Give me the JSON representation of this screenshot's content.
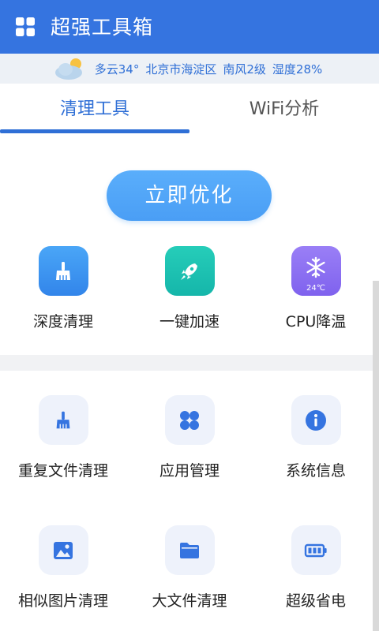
{
  "app": {
    "title": "超强工具箱"
  },
  "weather": {
    "condition_temp": "多云34°",
    "location": "北京市海淀区",
    "wind": "南风2级",
    "humidity": "湿度28%"
  },
  "tabs": [
    {
      "label": "清理工具",
      "active": true
    },
    {
      "label": "WiFi分析",
      "active": false
    }
  ],
  "optimize_button": {
    "label": "立即优化"
  },
  "top_tools": [
    {
      "label": "深度清理",
      "icon": "broom-icon",
      "color": "#3f95ef"
    },
    {
      "label": "一键加速",
      "icon": "rocket-icon",
      "color": "#1ec3b3"
    },
    {
      "label": "CPU降温",
      "icon": "snowflake-icon",
      "color": "#8b6ef2",
      "badge": "24℃"
    }
  ],
  "tools": [
    {
      "label": "重复文件清理",
      "icon": "broom-icon"
    },
    {
      "label": "应用管理",
      "icon": "apps-grid-icon"
    },
    {
      "label": "系统信息",
      "icon": "info-icon"
    },
    {
      "label": "相似图片清理",
      "icon": "image-icon"
    },
    {
      "label": "大文件清理",
      "icon": "folder-icon"
    },
    {
      "label": "超级省电",
      "icon": "battery-icon"
    }
  ],
  "colors": {
    "primary": "#3574e0",
    "accent": "#2f6fd6",
    "tile_bg": "#eef2fb"
  }
}
